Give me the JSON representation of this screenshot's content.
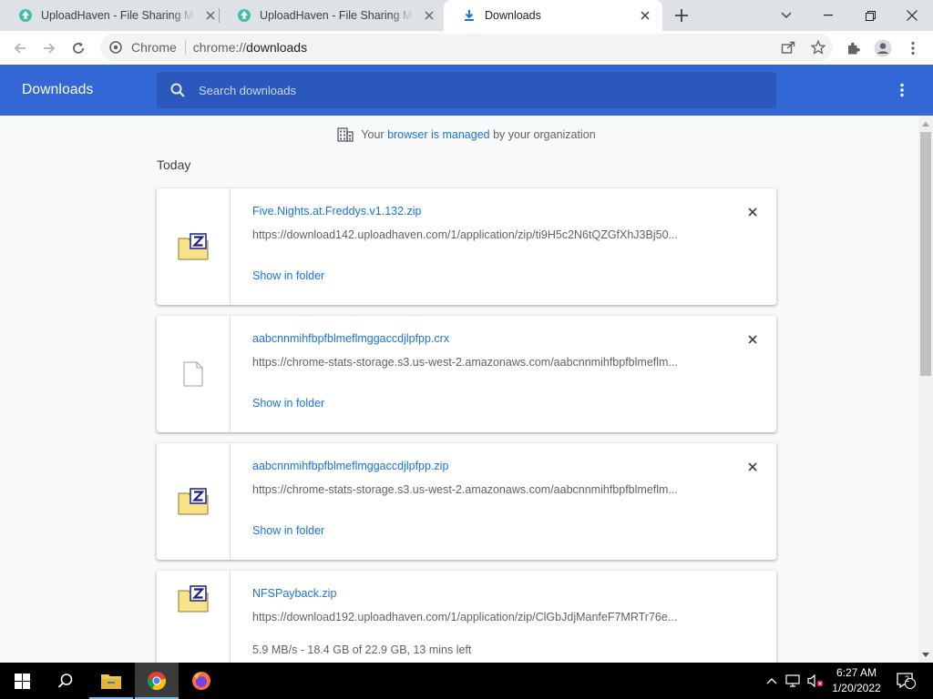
{
  "tabs": [
    {
      "label": "UploadHaven - File Sharing Made Simple",
      "active": false
    },
    {
      "label": "UploadHaven - File Sharing Made Simple",
      "active": false
    },
    {
      "label": "Downloads",
      "active": true
    }
  ],
  "toolbar": {
    "chip": "Chrome",
    "url_scheme": "chrome://",
    "url_host": "downloads"
  },
  "header": {
    "title": "Downloads",
    "search_placeholder": "Search downloads"
  },
  "managed": {
    "prefix": "Your ",
    "link": "browser is managed",
    "suffix": " by your organization"
  },
  "section_label": "Today",
  "downloads": [
    {
      "filename": "Five.Nights.at.Freddys.v1.132.zip",
      "url": "https://download142.uploadhaven.com/1/application/zip/ti9H5c2N6tQZGfXhJ3Bj50...",
      "action": "Show in folder",
      "icon": "zip-file-icon"
    },
    {
      "filename": "aabcnnmihfbpfblmeflmggaccdjlpfpp.crx",
      "url": "https://chrome-stats-storage.s3.us-west-2.amazonaws.com/aabcnnmihfbpfblmeflm...",
      "action": "Show in folder",
      "icon": "generic-file-icon"
    },
    {
      "filename": "aabcnnmihfbpfblmeflmggaccdjlpfpp.zip",
      "url": "https://chrome-stats-storage.s3.us-west-2.amazonaws.com/aabcnnmihfbpfblmeflm...",
      "action": "Show in folder",
      "icon": "zip-file-icon"
    },
    {
      "filename": "NFSPayback.zip",
      "url": "https://download192.uploadhaven.com/1/application/zip/ClGbJdjManfeF7MRTr76e...",
      "status": "5.9 MB/s - 18.4 GB of 22.9 GB, 13 mins left",
      "icon": "zip-file-icon"
    }
  ],
  "taskbar": {
    "time": "6:27 AM",
    "date": "1/20/2022",
    "notification_count": "2"
  },
  "colors": {
    "header_blue": "#3367d6",
    "search_blue": "#2b58bc",
    "link_blue": "#1a73e8"
  }
}
